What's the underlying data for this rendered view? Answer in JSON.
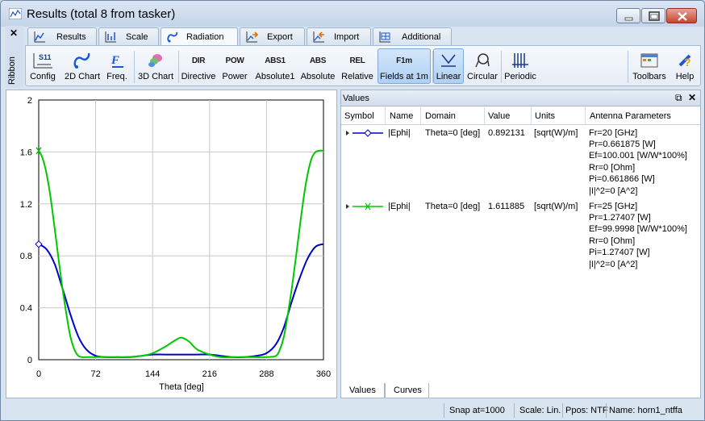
{
  "window": {
    "title": "Results (total 8 from tasker)"
  },
  "ribbon": {
    "side_label": "Ribbon",
    "close_label": "✕",
    "tabs": [
      {
        "label": "Results",
        "icon": "results-chart-icon",
        "active": false
      },
      {
        "label": "Scale",
        "icon": "scale-icon",
        "active": false
      },
      {
        "label": "Radiation",
        "icon": "radiation-icon",
        "active": true
      },
      {
        "label": "Export",
        "icon": "export-icon",
        "active": false
      },
      {
        "label": "Import",
        "icon": "import-icon",
        "active": false
      },
      {
        "label": "Additional",
        "icon": "additional-icon",
        "active": false
      }
    ],
    "buttons": {
      "config": {
        "label": "Config",
        "icon_text": "S11"
      },
      "chart2d": {
        "label": "2D Chart"
      },
      "freq": {
        "label": "Freq."
      },
      "chart3d": {
        "label": "3D Chart"
      },
      "directive": {
        "label": "Directive",
        "icon_text": "DIR"
      },
      "power": {
        "label": "Power",
        "icon_text": "POW"
      },
      "absolute1": {
        "label": "Absolute1",
        "icon_text": "ABS1"
      },
      "absolute": {
        "label": "Absolute",
        "icon_text": "ABS"
      },
      "relative": {
        "label": "Relative",
        "icon_text": "REL"
      },
      "fields1m": {
        "label": "Fields at 1m",
        "icon_text": "F1m",
        "active": true
      },
      "linear": {
        "label": "Linear",
        "active": true
      },
      "circular": {
        "label": "Circular"
      },
      "periodic": {
        "label": "Periodic"
      },
      "toolbars": {
        "label": "Toolbars"
      },
      "help": {
        "label": "Help"
      }
    }
  },
  "chart_data": {
    "type": "line",
    "xlabel": "Theta [deg]",
    "ylabel": "",
    "xlim": [
      0,
      360
    ],
    "ylim": [
      0,
      2
    ],
    "xticks": [
      "0",
      "72",
      "144",
      "216",
      "288",
      "360"
    ],
    "yticks": [
      "0",
      "0.4",
      "0.8",
      "1.2",
      "1.6",
      "2"
    ],
    "grid": true,
    "series": [
      {
        "name": "|Ephi| 20 GHz",
        "color": "#0000c8",
        "x": [
          0,
          10,
          20,
          30,
          40,
          50,
          60,
          72,
          85,
          100,
          115,
          130,
          144,
          160,
          180,
          200,
          216,
          230,
          245,
          260,
          275,
          288,
          300,
          310,
          320,
          330,
          340,
          350,
          360
        ],
        "y": [
          0.89,
          0.85,
          0.74,
          0.55,
          0.35,
          0.18,
          0.08,
          0.03,
          0.02,
          0.02,
          0.02,
          0.03,
          0.04,
          0.04,
          0.04,
          0.04,
          0.04,
          0.03,
          0.02,
          0.02,
          0.03,
          0.05,
          0.12,
          0.25,
          0.45,
          0.63,
          0.78,
          0.87,
          0.89
        ]
      },
      {
        "name": "|Ephi| 25 GHz",
        "color": "#00c800",
        "x": [
          0,
          5,
          10,
          15,
          20,
          25,
          30,
          35,
          40,
          45,
          50,
          55,
          60,
          72,
          90,
          110,
          130,
          144,
          160,
          170,
          180,
          190,
          200,
          216,
          230,
          250,
          270,
          288,
          300,
          305,
          310,
          315,
          320,
          325,
          330,
          335,
          340,
          345,
          350,
          355,
          360
        ],
        "y": [
          1.61,
          1.55,
          1.43,
          1.25,
          1.02,
          0.78,
          0.55,
          0.35,
          0.18,
          0.08,
          0.03,
          0.02,
          0.02,
          0.02,
          0.02,
          0.02,
          0.03,
          0.05,
          0.1,
          0.14,
          0.17,
          0.14,
          0.08,
          0.04,
          0.02,
          0.02,
          0.02,
          0.02,
          0.03,
          0.08,
          0.18,
          0.35,
          0.55,
          0.78,
          1.02,
          1.25,
          1.43,
          1.55,
          1.6,
          1.61,
          1.61
        ]
      }
    ]
  },
  "values_panel": {
    "title": "Values",
    "pin": "⧉",
    "close": "✕",
    "columns": [
      "Symbol",
      "Name",
      "Domain",
      "Value",
      "Units",
      "Antenna Parameters"
    ],
    "rows": [
      {
        "color": "#0000c8",
        "marker": "diamond",
        "name": "|Ephi|",
        "domain": "Theta=0 [deg]",
        "value": "0.892131",
        "units": "[sqrt(W)/m]",
        "params": [
          "Fr=20 [GHz]",
          "Pr=0.661875 [W]",
          "Ef=100.001 [W/W*100%]",
          "Rr=0 [Ohm]",
          "Pi=0.661866 [W]",
          "|I|^2=0 [A^2]"
        ]
      },
      {
        "color": "#00c800",
        "marker": "x",
        "name": "|Ephi|",
        "domain": "Theta=0 [deg]",
        "value": "1.611885",
        "units": "[sqrt(W)/m]",
        "params": [
          "Fr=25 [GHz]",
          "Pr=1.27407 [W]",
          "Ef=99.9998 [W/W*100%]",
          "Rr=0 [Ohm]",
          "Pi=1.27407 [W]",
          "|I|^2=0 [A^2]"
        ]
      }
    ],
    "bottom_tabs": [
      "Values",
      "Curves"
    ]
  },
  "statusbar": {
    "snap": "Snap at=1000",
    "scale": "Scale: Lin.",
    "ppos": "Ppos: NTF",
    "name": "Name: horn1_ntffa"
  }
}
